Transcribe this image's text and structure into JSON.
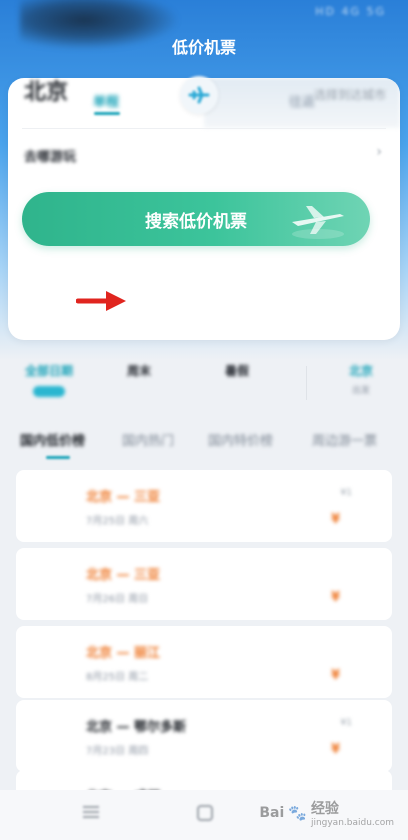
{
  "status_bar": {
    "time": "",
    "icons": "HD 4G 5G"
  },
  "header": {
    "title": "低价机票"
  },
  "search_card": {
    "tabs": [
      {
        "label": "单程",
        "active": true
      },
      {
        "label": "往返",
        "active": false
      }
    ],
    "from_city": "北京",
    "to_city": "选择到达城市",
    "date": "去哪游玩",
    "search_button": "搜索低价机票"
  },
  "quick_filters": [
    {
      "title": "全部日期",
      "sub": "",
      "active": true
    },
    {
      "title": "周末",
      "sub": "",
      "active": false
    },
    {
      "title": "暑假",
      "sub": "",
      "active": false
    },
    {
      "title": "北京",
      "sub": "出发",
      "active": false
    }
  ],
  "category_tabs": [
    {
      "label": "国内低价榜",
      "active": true
    },
    {
      "label": "国内热门",
      "active": false
    },
    {
      "label": "国内特价榜",
      "active": false
    },
    {
      "label": "周边游一票",
      "active": false
    }
  ],
  "flights": [
    {
      "dest": "北京 — 三亚",
      "sub": "7月25日 周六",
      "price": "¥",
      "tag": "¥1",
      "dest_color": "#ee7a2c"
    },
    {
      "dest": "北京 — 三亚",
      "sub": "7月26日 周日",
      "price": "¥",
      "tag": "",
      "dest_color": "#ee7a2c"
    },
    {
      "dest": "北京 — 丽江",
      "sub": "8月25日 周二",
      "price": "¥",
      "tag": "",
      "dest_color": "#ee7a2c"
    },
    {
      "dest": "北京 — 鄂尔多斯",
      "sub": "7月23日 周四",
      "price": "¥",
      "tag": "¥1",
      "dest_color": "#1f2329"
    },
    {
      "dest": "北京 — 成都",
      "sub": "",
      "price": "",
      "tag": "",
      "dest_color": "#1f2329"
    }
  ],
  "watermark": {
    "brand": "Bai",
    "suffix": "经验",
    "sub": "jingyan.baidu.com"
  },
  "colors": {
    "accent": "#1aa3b8",
    "search_button": "#2fb48c",
    "price": "#ee7a2c",
    "annotation_arrow": "#e0251f"
  }
}
